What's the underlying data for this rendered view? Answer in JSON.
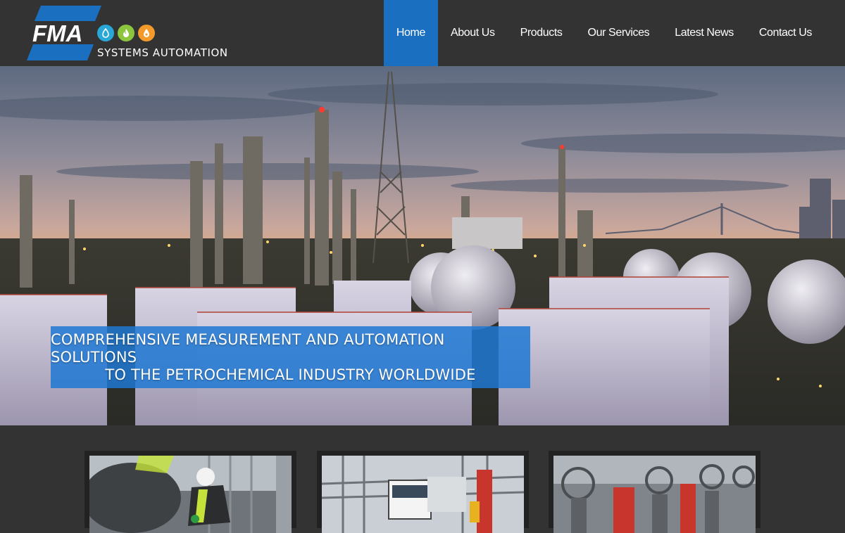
{
  "brand": {
    "logo_text": "FMA",
    "tagline": "SYSTEMS AUTOMATION",
    "accent_color": "#1b6fc0",
    "utility_icons": [
      {
        "name": "water-drop-icon",
        "color": "#29a8d8"
      },
      {
        "name": "flame-icon",
        "color": "#8cc63f"
      },
      {
        "name": "oil-drop-icon",
        "color": "#f39a2b"
      }
    ]
  },
  "nav": {
    "items": [
      {
        "label": "Home",
        "active": true
      },
      {
        "label": "About Us",
        "active": false
      },
      {
        "label": "Products",
        "active": false
      },
      {
        "label": "Our Services",
        "active": false
      },
      {
        "label": "Latest News",
        "active": false
      },
      {
        "label": "Contact Us",
        "active": false
      }
    ]
  },
  "hero": {
    "caption_line1": "COMPREHENSIVE MEASUREMENT AND AUTOMATION SOLUTIONS",
    "caption_line2": "TO THE PETROCHEMICAL INDUSTRY WORLDWIDE"
  },
  "cards": [
    {
      "image": "engineer-working-photo"
    },
    {
      "image": "tanker-truck-at-plant-photo"
    },
    {
      "image": "industrial-valves-photo"
    }
  ]
}
